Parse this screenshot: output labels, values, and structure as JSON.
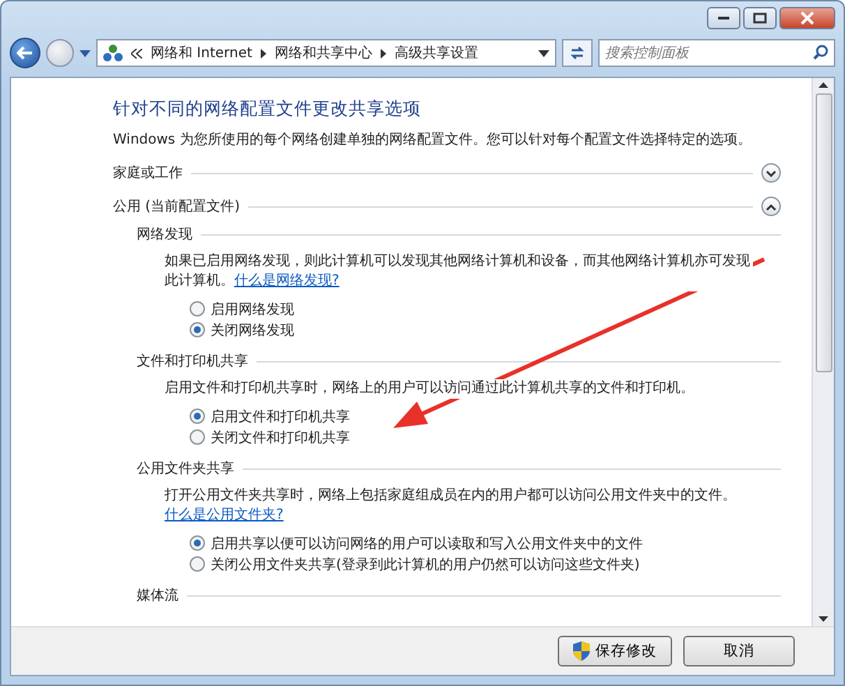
{
  "breadcrumb": {
    "items": [
      "网络和 Internet",
      "网络和共享中心",
      "高级共享设置"
    ]
  },
  "search": {
    "placeholder": "搜索控制面板"
  },
  "heading": "针对不同的网络配置文件更改共享选项",
  "description": "Windows 为您所使用的每个网络创建单独的网络配置文件。您可以针对每个配置文件选择特定的选项。",
  "profiles": [
    {
      "label": "家庭或工作",
      "expanded": false
    },
    {
      "label": "公用 (当前配置文件)",
      "expanded": true,
      "sections": [
        {
          "title": "网络发现",
          "text": "如果已启用网络发现，则此计算机可以发现其他网络计算机和设备，而其他网络计算机亦可发现此计算机。",
          "link": "什么是网络发现?",
          "options": [
            {
              "label": "启用网络发现",
              "selected": false
            },
            {
              "label": "关闭网络发现",
              "selected": true
            }
          ]
        },
        {
          "title": "文件和打印机共享",
          "text": "启用文件和打印机共享时，网络上的用户可以访问通过此计算机共享的文件和打印机。",
          "options": [
            {
              "label": "启用文件和打印机共享",
              "selected": true
            },
            {
              "label": "关闭文件和打印机共享",
              "selected": false
            }
          ]
        },
        {
          "title": "公用文件夹共享",
          "text": "打开公用文件夹共享时，网络上包括家庭组成员在内的用户都可以访问公用文件夹中的文件。",
          "link": "什么是公用文件夹?",
          "options": [
            {
              "label": "启用共享以便可以访问网络的用户可以读取和写入公用文件夹中的文件",
              "selected": true
            },
            {
              "label": "关闭公用文件夹共享(登录到此计算机的用户仍然可以访问这些文件夹)",
              "selected": false
            }
          ]
        },
        {
          "title": "媒体流"
        }
      ]
    }
  ],
  "buttons": [
    {
      "label": "保存修改",
      "kind": "shield"
    },
    {
      "label": "取消",
      "kind": "plain"
    }
  ]
}
